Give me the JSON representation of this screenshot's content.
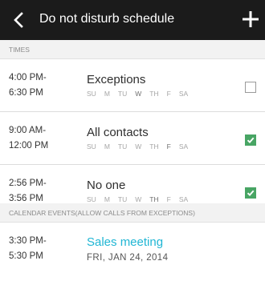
{
  "header": {
    "title": "Do not disturb schedule"
  },
  "sections": {
    "times": "TIMES",
    "calendar": "CALENDAR EVENTS(ALLOW CALLS FROM EXCEPTIONS)"
  },
  "schedules": [
    {
      "start": "4:00 PM-",
      "end": "6:30 PM",
      "title": "Exceptions",
      "days": [
        "SU",
        "M",
        "TU",
        "W",
        "TH",
        "F",
        "SA"
      ],
      "active_days": [
        "W"
      ],
      "checked": false
    },
    {
      "start": "9:00 AM-",
      "end": "12:00 PM",
      "title": "All contacts",
      "days": [
        "SU",
        "M",
        "TU",
        "W",
        "TH",
        "F",
        "SA"
      ],
      "active_days": [
        "F"
      ],
      "checked": true
    },
    {
      "start": "2:56 PM-",
      "end": "3:56 PM",
      "title": "No one",
      "days": [
        "SU",
        "M",
        "TU",
        "W",
        "TH",
        "F",
        "SA"
      ],
      "active_days": [
        "TH"
      ],
      "checked": true
    }
  ],
  "event": {
    "start": "3:30 PM-",
    "end": "5:30 PM",
    "title": "Sales meeting",
    "date": "FRI, JAN 24, 2014"
  },
  "colors": {
    "app_bar": "#1b1b1b",
    "check_green": "#48a564",
    "event_accent": "#20b6d4"
  },
  "icons": {
    "back": "back-arrow-icon",
    "add": "plus-icon",
    "check": "checkmark-icon"
  }
}
